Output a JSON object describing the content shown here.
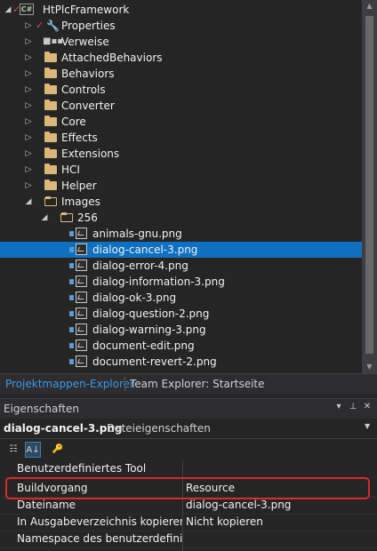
{
  "solution_explorer": {
    "project": "HtPlcFramework",
    "project_icon": "C#",
    "items": [
      {
        "label": "Properties",
        "icon": "wrench-icon"
      },
      {
        "label": "Verweise",
        "icon": "references-icon"
      },
      {
        "label": "AttachedBehaviors",
        "icon": "folder-icon"
      },
      {
        "label": "Behaviors",
        "icon": "folder-icon"
      },
      {
        "label": "Controls",
        "icon": "folder-icon"
      },
      {
        "label": "Converter",
        "icon": "folder-icon"
      },
      {
        "label": "Core",
        "icon": "folder-icon"
      },
      {
        "label": "Effects",
        "icon": "folder-icon"
      },
      {
        "label": "Extensions",
        "icon": "folder-icon"
      },
      {
        "label": "HCI",
        "icon": "folder-icon"
      },
      {
        "label": "Helper",
        "icon": "folder-icon"
      },
      {
        "label": "Images",
        "icon": "folder-icon"
      },
      {
        "label": "256",
        "icon": "folder-open-icon"
      }
    ],
    "files": [
      "animals-gnu.png",
      "dialog-cancel-3.png",
      "dialog-error-4.png",
      "dialog-information-3.png",
      "dialog-ok-3.png",
      "dialog-question-2.png",
      "dialog-warning-3.png",
      "document-edit.png",
      "document-revert-2.png"
    ],
    "selected_file": "dialog-cancel-3.png"
  },
  "tabs": [
    {
      "label": "Projektmappen-Explorer",
      "active": true
    },
    {
      "label": "Team Explorer: Startseite",
      "active": false
    }
  ],
  "properties": {
    "title": "Eigenschaften",
    "object_name": "dialog-cancel-3.png",
    "object_type": "Dateieigenschaften",
    "rows": [
      {
        "key": "Benutzerdefiniertes Tool",
        "value": ""
      },
      {
        "key": "Buildvorgang",
        "value": "Resource"
      },
      {
        "key": "Dateiname",
        "value": "dialog-cancel-3.png"
      },
      {
        "key": "In Ausgabeverzeichnis kopieren",
        "value": "Nicht kopieren"
      },
      {
        "key": "Namespace des benutzerdefinierten",
        "value": ""
      }
    ]
  },
  "colors": {
    "background": "#252526",
    "selection": "#0e70c0",
    "active_tab": "#3c9ae8",
    "highlight_box": "#d62b2b",
    "folder": "#dcb67a"
  }
}
